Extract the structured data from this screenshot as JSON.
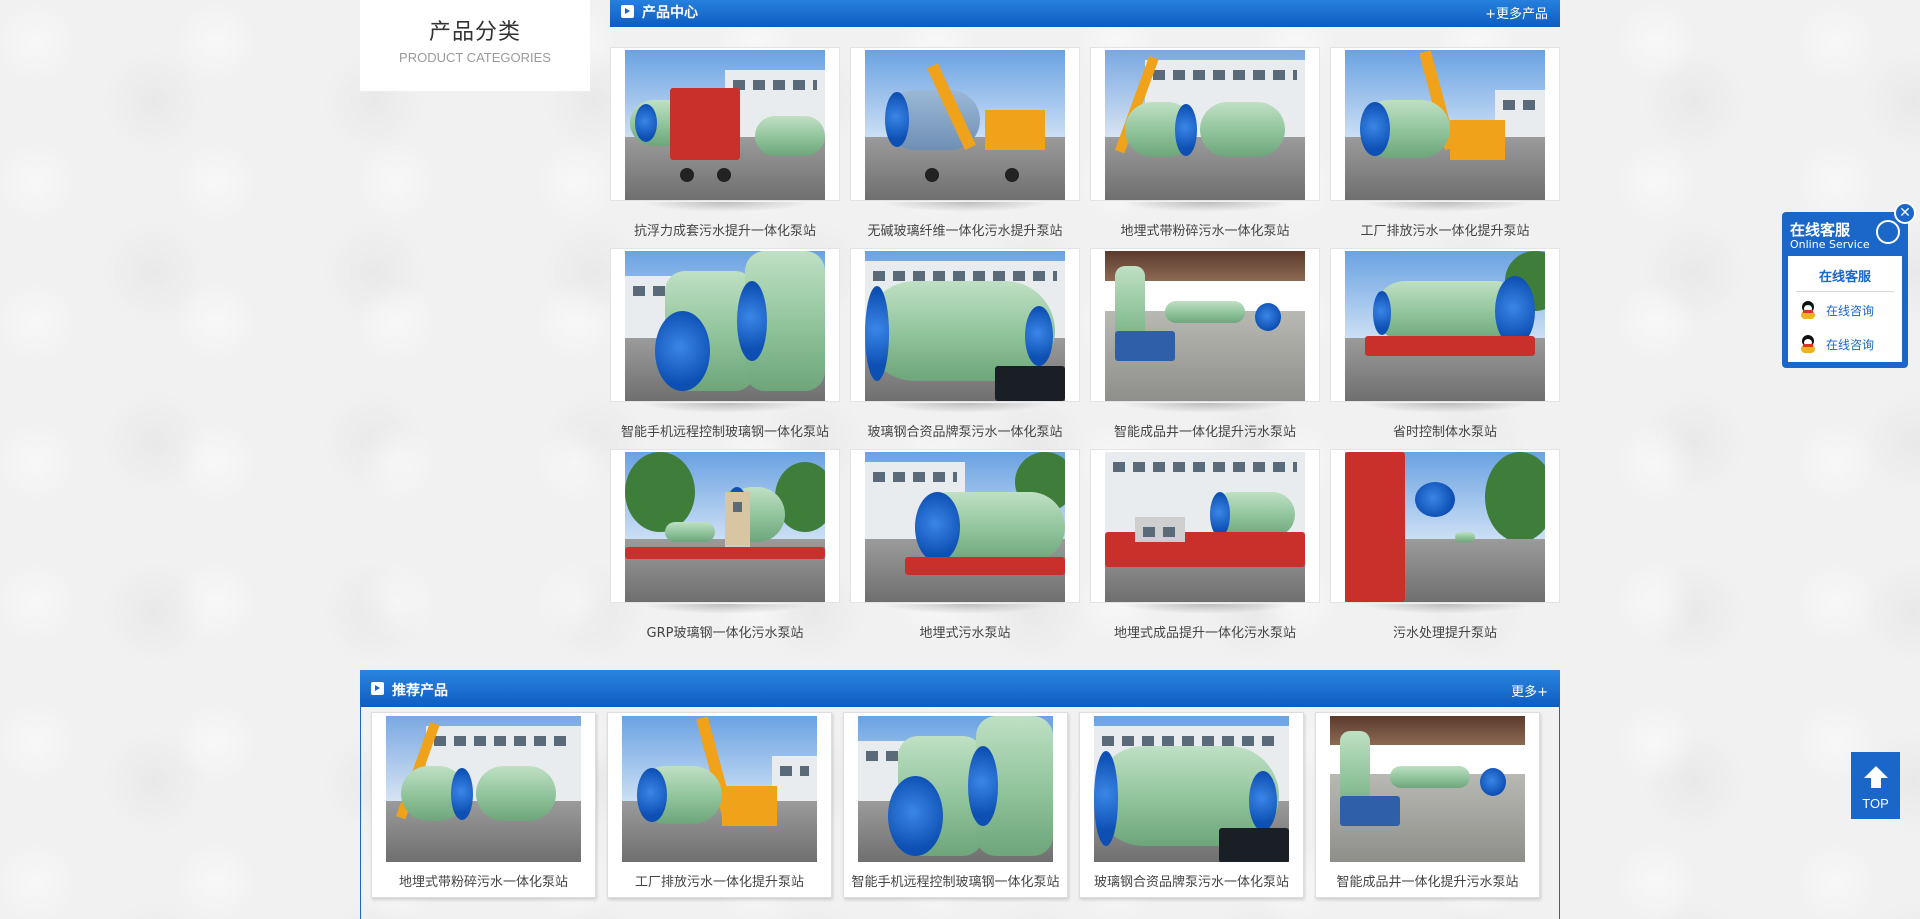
{
  "categories": {
    "title_cn": "产品分类",
    "title_en": "PRODUCT CATEGORIES"
  },
  "product_center": {
    "title": "产品中心",
    "more": "+更多产品",
    "items": [
      "抗浮力成套污水提升一体化泵站",
      "无碱玻璃纤维一体化污水提升泵站",
      "地埋式带粉碎污水一体化泵站",
      "工厂排放污水一体化提升泵站",
      "智能手机远程控制玻璃钢一体化泵站",
      "玻璃钢合资品牌泵污水一体化泵站",
      "智能成品井一体化提升污水泵站",
      "省时控制体水泵站",
      "GRP玻璃钢一体化污水泵站",
      "地埋式污水泵站",
      "地埋式成品提升一体化污水泵站",
      "污水处理提升泵站"
    ]
  },
  "recommended": {
    "title": "推荐产品",
    "more": "更多+",
    "items": [
      "地埋式带粉碎污水一体化泵站",
      "工厂排放污水一体化提升泵站",
      "智能手机远程控制玻璃钢一体化泵站",
      "玻璃钢合资品牌泵污水一体化泵站",
      "智能成品井一体化提升污水泵站"
    ]
  },
  "online_service": {
    "title_cn": "在线客服",
    "title_en": "Online Service",
    "close": "✕",
    "body_title": "在线客服",
    "links": [
      "在线咨询",
      "在线咨询"
    ]
  },
  "top_button": {
    "label": "TOP"
  },
  "colors": {
    "brand_blue": "#1a66c9",
    "header_gradient_top": "#2a86e0"
  }
}
